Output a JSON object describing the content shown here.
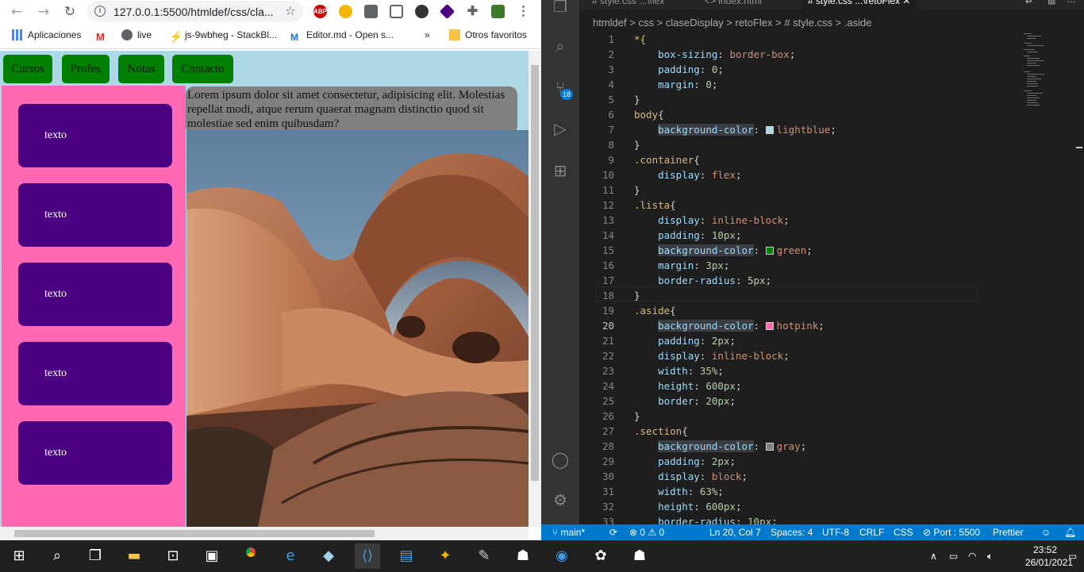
{
  "browser": {
    "url": "127.0.0.1:5500/htmldef/css/cla...",
    "bookmarks": {
      "apps": "Aplicaciones",
      "live": "live",
      "stackblitz": "js-9wbheg - StackBl...",
      "editor": "Editor.md - Open s...",
      "more": "»",
      "others": "Otros favoritos"
    },
    "extensions": {
      "abp": "ABP"
    }
  },
  "page": {
    "nav": [
      "Cursos",
      "Profes",
      "Notas",
      "Contacto"
    ],
    "cards": [
      "texto",
      "texto",
      "texto",
      "texto",
      "texto"
    ],
    "lorem": "Lorem ipsum dolor sit amet consectetur, adipisicing elit. Molestias repellat modi, atque rerum quaerat magnam distinctio quod sit molestiae sed enim quibusdam?"
  },
  "vscode": {
    "tabs": [
      "# style.css ...\\flex",
      "<> index.html",
      "# style.css ...\\retoFlex"
    ],
    "breadcrumb": "htmldef  >  css  >  claseDisplay  >  retoFlex  >  #  style.css  >  .aside",
    "scm_badge": "18",
    "colors": {
      "lightblue": "#add8e6",
      "green": "#008000",
      "hotpink": "#ff69b4",
      "gray": "#808080"
    },
    "status": {
      "branch": "main*",
      "problems": "⊗ 0 ⚠ 0",
      "position": "Ln 20, Col 7",
      "spaces": "Spaces: 4",
      "encoding": "UTF-8",
      "eol": "CRLF",
      "language": "CSS",
      "port": "⊘ Port : 5500",
      "prettier": "Prettier"
    }
  },
  "taskbar": {
    "time": "23:52",
    "date": "26/01/2021"
  }
}
